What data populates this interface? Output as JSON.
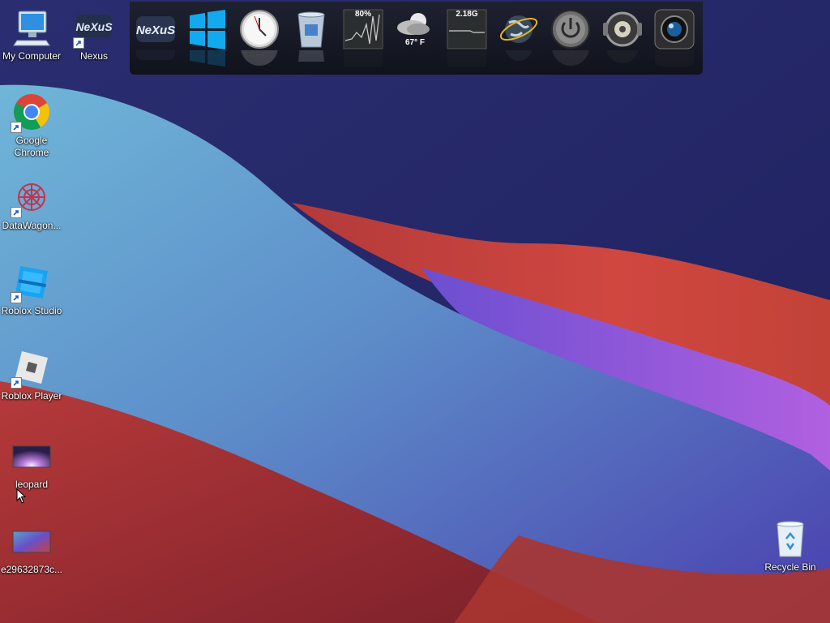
{
  "desktop": {
    "icons": [
      {
        "label": "My Computer",
        "icon": "monitor-icon",
        "shortcut": false
      },
      {
        "label": "Nexus",
        "icon": "nexus-logo-icon",
        "shortcut": true
      },
      {
        "label": "Google Chrome",
        "icon": "chrome-icon",
        "shortcut": true
      },
      {
        "label": "DataWagon...",
        "icon": "datawagon-icon",
        "shortcut": true
      },
      {
        "label": "Roblox Studio",
        "icon": "roblox-studio-icon",
        "shortcut": true
      },
      {
        "label": "Roblox Player",
        "icon": "roblox-player-icon",
        "shortcut": true
      },
      {
        "label": "leopard",
        "icon": "image-thumbnail-icon",
        "shortcut": false
      },
      {
        "label": "e29632873c...",
        "icon": "image-thumbnail-icon",
        "shortcut": false
      },
      {
        "label": "Recycle Bin",
        "icon": "recycle-bin-icon",
        "shortcut": false
      }
    ]
  },
  "dock": {
    "items": [
      {
        "name": "nexus",
        "icon": "nexus-logo-icon"
      },
      {
        "name": "start",
        "icon": "windows-logo-icon"
      },
      {
        "name": "clock",
        "icon": "clock-icon"
      },
      {
        "name": "recycle",
        "icon": "trash-icon"
      },
      {
        "name": "cpu-meter",
        "icon": "cpu-meter-icon"
      },
      {
        "name": "weather",
        "icon": "weather-icon"
      },
      {
        "name": "ram-meter",
        "icon": "ram-meter-icon"
      },
      {
        "name": "network",
        "icon": "globe-icon"
      },
      {
        "name": "power",
        "icon": "power-icon"
      },
      {
        "name": "media",
        "icon": "speaker-icon"
      },
      {
        "name": "camera",
        "icon": "camera-icon"
      }
    ],
    "cpu_percent": "80%",
    "temperature": "67° F",
    "memory": "2.18G",
    "nexus_text": "NeXuS"
  },
  "colors": {
    "wallpaper_blue": "#5aa2c8",
    "wallpaper_red": "#c7403c",
    "wallpaper_purple": "#8a56d8",
    "wallpaper_navy": "#262866",
    "dock_bg": "#141722"
  }
}
